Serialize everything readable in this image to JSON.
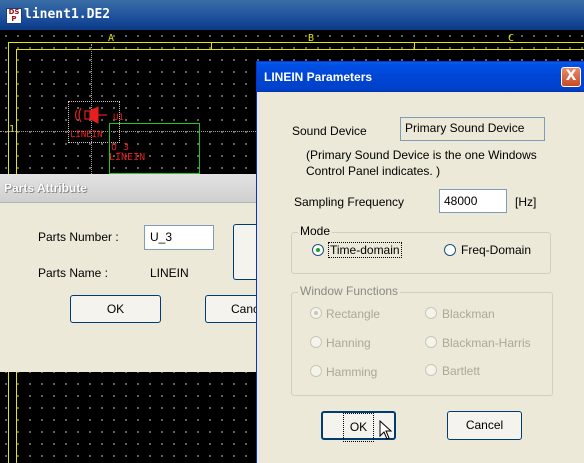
{
  "background_window": {
    "title": "linent1.DE2",
    "app_icon_text": [
      "D",
      "S",
      "P"
    ],
    "columns": [
      "A",
      "B",
      "C"
    ],
    "row_label": "1",
    "component": {
      "ref_top": "U1",
      "name_small": "LINEIN",
      "ref": "U_3",
      "name": "LINEIN"
    },
    "colors": {
      "frame": "#e6e600",
      "component_text": "#e61e1e",
      "wire": "#22c822"
    }
  },
  "parts_attribute": {
    "title": "Parts Attribute",
    "parts_number_label": "Parts Number :",
    "parts_number_value": "U_3",
    "parts_name_label": "Parts Name :",
    "parts_name_value": "LINEIN",
    "ok_label": "OK",
    "cancel_label": "Canc"
  },
  "linein_params": {
    "title": "LINEIN Parameters",
    "close_label": "X",
    "sound_device_label": "Sound Device",
    "sound_device_value": "Primary Sound Device",
    "sound_device_note": "(Primary Sound Device is the one Windows Control Panel indicates. )",
    "sampling_label": "Sampling Frequency",
    "sampling_value": "48000",
    "sampling_unit": "[Hz]",
    "mode_group": "Mode",
    "mode_options": [
      {
        "label": "Time-domain",
        "selected": true
      },
      {
        "label": "Freq-Domain",
        "selected": false
      }
    ],
    "window_group": "Window Functions",
    "window_options": [
      {
        "label": "Rectangle",
        "selected": true
      },
      {
        "label": "Blackman",
        "selected": false
      },
      {
        "label": "Hanning",
        "selected": false
      },
      {
        "label": "Blackman-Harris",
        "selected": false
      },
      {
        "label": "Hamming",
        "selected": false
      },
      {
        "label": "Bartlett",
        "selected": false
      }
    ],
    "ok_label": "OK",
    "cancel_label": "Cancel"
  }
}
